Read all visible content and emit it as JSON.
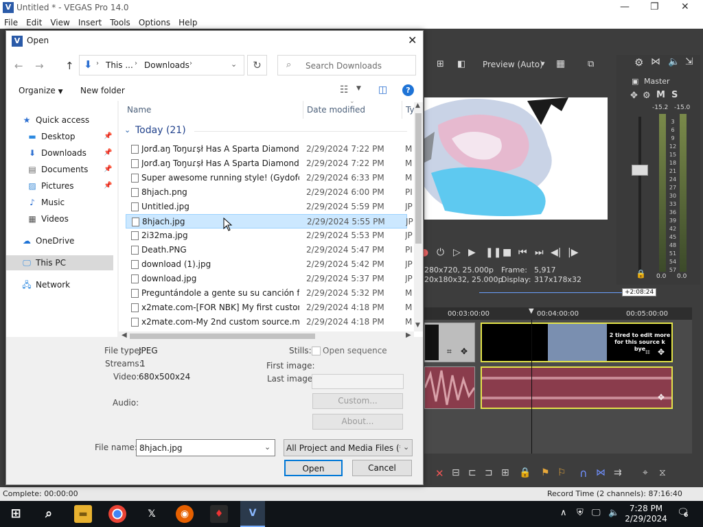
{
  "vegas": {
    "title": "Untitled * - VEGAS Pro 14.0",
    "menu": [
      "File",
      "Edit",
      "View",
      "Insert",
      "Tools",
      "Options",
      "Help"
    ],
    "preview": {
      "quality_label": "Preview (Auto)",
      "project_info": "280x720, 25.000p",
      "preview_info": "20x180x32, 25.000p",
      "frame_label": "Frame:",
      "frame_value": "5,917",
      "display_label": "Display:",
      "display_value": "317x178x32"
    },
    "mixer": {
      "master_label": "Master",
      "left_peak": "-15.2",
      "right_peak": "-15.0",
      "scale": [
        "3",
        "6",
        "9",
        "12",
        "15",
        "18",
        "21",
        "24",
        "27",
        "30",
        "33",
        "36",
        "39",
        "42",
        "45",
        "48",
        "51",
        "54",
        "57"
      ],
      "left_bottom": "0.0",
      "right_bottom": "0.0"
    },
    "timeline": {
      "cursor_time": "+2:08:24",
      "ruler_marks": [
        "00:03:00:00",
        "00:04:00:00",
        "00:05:00:00"
      ],
      "clip_text": "2 tired to edit more for this source k bye"
    },
    "status": {
      "complete": "Complete: 00:00:00",
      "record_time": "Record Time (2 channels): 87:16:40"
    }
  },
  "dialog": {
    "title": "Open",
    "breadcrumb": [
      "This ...",
      "Downloads"
    ],
    "search_placeholder": "Search Downloads",
    "organize_label": "Organize",
    "new_folder_label": "New folder",
    "nav": {
      "quick_access": "Quick access",
      "desktop": "Desktop",
      "downloads": "Downloads",
      "documents": "Documents",
      "pictures": "Pictures",
      "music": "Music",
      "videos": "Videos",
      "onedrive": "OneDrive",
      "this_pc": "This PC",
      "network": "Network"
    },
    "columns": {
      "name": "Name",
      "date": "Date modified",
      "type": "Ty"
    },
    "group_label": "Today (21)",
    "files": [
      {
        "name": "Jorđ.aŋ Toŋuɾṣł Has A Sparta Diamond ...",
        "date": "2/29/2024 7:22 PM",
        "type": "M"
      },
      {
        "name": "Jorđ.aŋ Toŋuɾṣł Has A Sparta Diamond ...",
        "date": "2/29/2024 7:22 PM",
        "type": "M"
      },
      {
        "name": "Super awesome running style! (Gydofc L...",
        "date": "2/29/2024 6:33 PM",
        "type": "M"
      },
      {
        "name": "8hjach.png",
        "date": "2/29/2024 6:00 PM",
        "type": "PI"
      },
      {
        "name": "Untitled.jpg",
        "date": "2/29/2024 5:59 PM",
        "type": "JP"
      },
      {
        "name": "8hjach.jpg",
        "date": "2/29/2024 5:55 PM",
        "type": "JP"
      },
      {
        "name": "2i32ma.jpg",
        "date": "2/29/2024 5:53 PM",
        "type": "JP"
      },
      {
        "name": "Death.PNG",
        "date": "2/29/2024 5:47 PM",
        "type": "PI"
      },
      {
        "name": "download (1).jpg",
        "date": "2/29/2024 5:42 PM",
        "type": "JP"
      },
      {
        "name": "download.jpg",
        "date": "2/29/2024 5:37 PM",
        "type": "JP"
      },
      {
        "name": "Preguntándole a gente su su canción fav...",
        "date": "2/29/2024 5:32 PM",
        "type": "M"
      },
      {
        "name": "x2mate.com-[FOR NBK] My first custom ...",
        "date": "2/29/2024 4:18 PM",
        "type": "M"
      },
      {
        "name": "x2mate.com-My 2nd custom source.mp4",
        "date": "2/29/2024 4:18 PM",
        "type": "M"
      }
    ],
    "details": {
      "file_type_label": "File type:",
      "file_type": "JPEG",
      "streams_label": "Streams:",
      "streams": "1",
      "video_label": "Video:",
      "video": "680x500x24",
      "audio_label": "Audio:",
      "stills_label": "Stills:",
      "open_sequence": "Open sequence",
      "first_image_label": "First image:",
      "last_image_label": "Last image:",
      "custom_label": "Custom...",
      "about_label": "About..."
    },
    "file_name_label": "File name:",
    "file_name_value": "8hjach.jpg",
    "filter_value": "All Project and Media Files (*.ve",
    "open_label": "Open",
    "cancel_label": "Cancel"
  },
  "taskbar": {
    "time": "7:28 PM",
    "date": "2/29/2024",
    "notifications": "6"
  }
}
